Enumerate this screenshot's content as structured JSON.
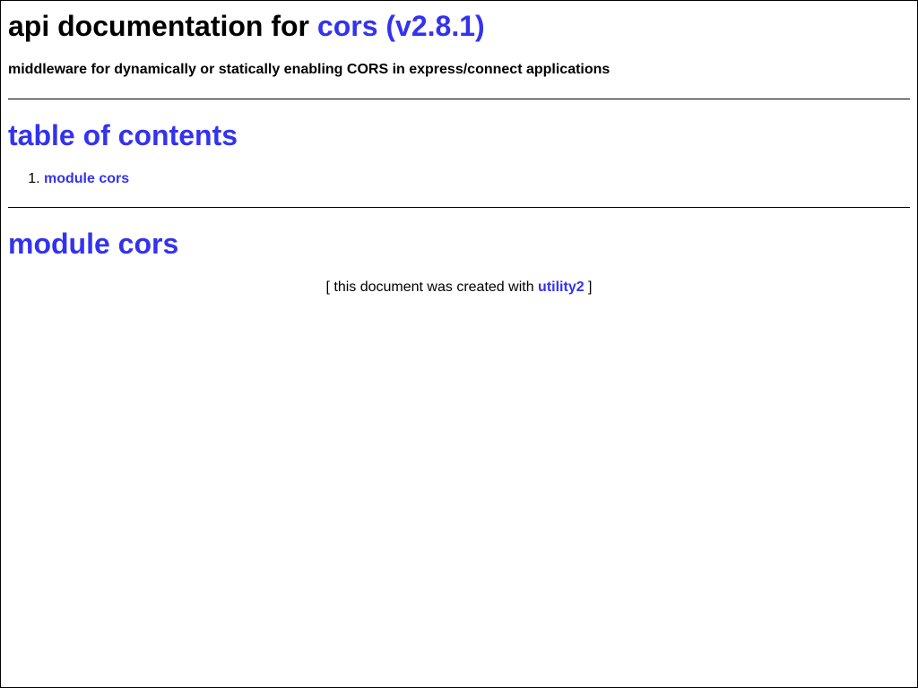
{
  "header": {
    "title_prefix": "api documentation for ",
    "title_link": "cors (v2.8.1)",
    "subtitle": "middleware for dynamically or statically enabling CORS in express/connect applications"
  },
  "toc": {
    "heading": "table of contents",
    "items": [
      {
        "label": "module cors"
      }
    ]
  },
  "module": {
    "heading": "module cors"
  },
  "footer": {
    "prefix": "[ this document was created with ",
    "link": "utility2",
    "suffix": " ]"
  },
  "colors": {
    "link": "#3333ee",
    "text": "#000000",
    "background": "#ffffff"
  }
}
